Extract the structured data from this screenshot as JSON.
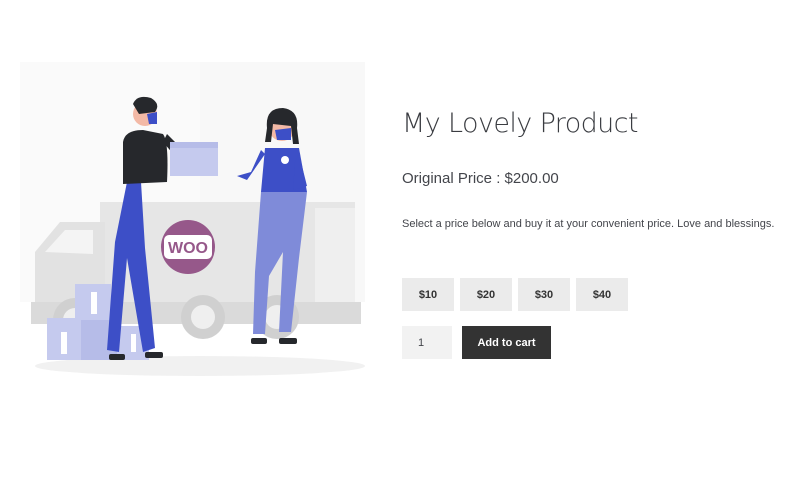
{
  "product": {
    "title": "My Lovely Product",
    "original_price_label": "Original Price : $200.00",
    "description": "Select a price below and buy it at your convenient price. Love and blessings.",
    "price_options": [
      "$10",
      "$20",
      "$30",
      "$40"
    ],
    "quantity": "1",
    "add_to_cart_label": "Add to cart"
  },
  "illustration": {
    "truck_logo_text": "WOO",
    "colors": {
      "accent_blue": "#3d4fc7",
      "light_blue": "#7f8bd9",
      "pale_blue": "#c5caee",
      "woo_purple": "#96588a",
      "truck_grey": "#e6e6e6",
      "button_dark": "#333333",
      "button_light": "#ebebeb"
    }
  }
}
